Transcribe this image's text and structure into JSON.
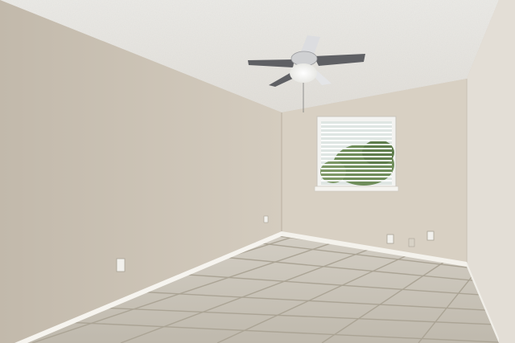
{
  "scene": {
    "type": "photo",
    "subject": "empty-room-interior"
  },
  "palette": {
    "ceiling": "#e9e7e2",
    "left_wall": "#cdc4b6",
    "back_wall": "#d9d1c4",
    "right_wall": "#e4dfd7",
    "floor_tile": "#cbc6bb",
    "grout": "#aaa395",
    "baseboard": "#f6f4ef",
    "window_frame": "#f3f3f1",
    "window_glass": "#dfe6e3",
    "window_foliage": "#6f8d5a",
    "fan_blade": "#5f6064",
    "fan_body": "#cfd0d2",
    "fan_light": "#f7f7f4",
    "outlet": "#f2f1ed"
  },
  "objects": [
    {
      "name": "ceiling-fan",
      "icon": "ceiling-fan-icon",
      "blades": 4,
      "light_on": true
    },
    {
      "name": "window",
      "icon": "window-with-blinds-icon",
      "state": "blinds-half-open"
    },
    {
      "name": "floor",
      "icon": "tile-floor-icon",
      "material": "ceramic-tile"
    },
    {
      "name": "wall-outlets",
      "icon": "outlet-icon",
      "count": 4
    }
  ]
}
